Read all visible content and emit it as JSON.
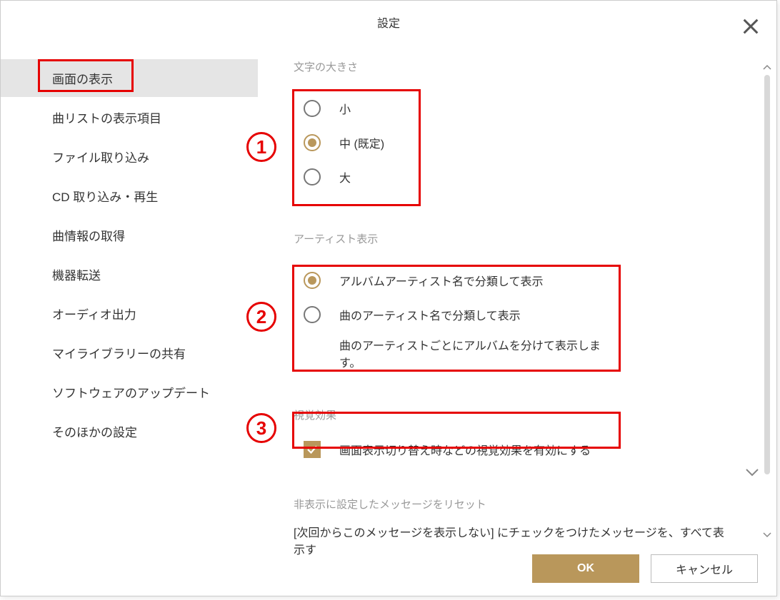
{
  "title": "設定",
  "sidebar": {
    "items": [
      "画面の表示",
      "曲リストの表示項目",
      "ファイル取り込み",
      "CD 取り込み・再生",
      "曲情報の取得",
      "機器転送",
      "オーディオ出力",
      "マイライブラリーの共有",
      "ソフトウェアのアップデート",
      "そのほかの設定"
    ],
    "activeIndex": 0
  },
  "sections": {
    "fontSize": {
      "label": "文字の大きさ",
      "options": [
        "小",
        "中 (既定)",
        "大"
      ],
      "selected": 1
    },
    "artistDisplay": {
      "label": "アーティスト表示",
      "options": [
        "アルバムアーティスト名で分類して表示",
        "曲のアーティスト名で分類して表示"
      ],
      "description": "曲のアーティストごとにアルバムを分けて表示します。",
      "selected": 0
    },
    "visualEffect": {
      "label": "視覚効果",
      "checkboxLabel": "画面表示切り替え時などの視覚効果を有効にする",
      "checked": true
    },
    "resetHidden": {
      "label": "非表示に設定したメッセージをリセット",
      "text": "[次回からこのメッセージを表示しない] にチェックをつけたメッセージを、すべて表示す"
    }
  },
  "buttons": {
    "ok": "OK",
    "cancel": "キャンセル"
  },
  "annotations": {
    "n1": "1",
    "n2": "2",
    "n3": "3"
  }
}
